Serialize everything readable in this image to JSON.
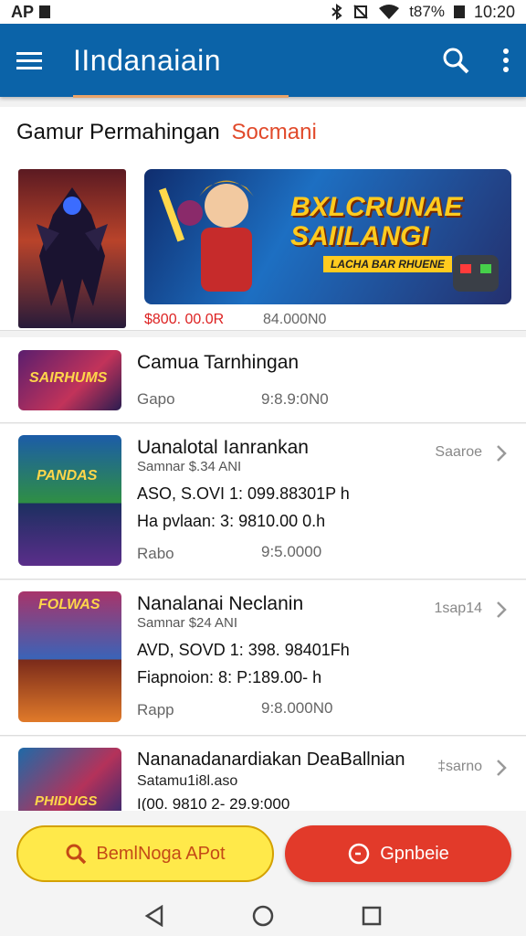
{
  "status_bar": {
    "left_text": "AP",
    "battery": "t87%",
    "time": "10:20"
  },
  "app_bar": {
    "title": "IIndanaiain",
    "menu_icon": "menu-icon",
    "search_icon": "search-icon",
    "more_icon": "more-vert-icon",
    "color": "#0b63a8"
  },
  "featured": {
    "heading": "Gamur Permahingan",
    "heading_accent": "Socmani",
    "banner_title": "BXLCRUNAE SAIILANGI",
    "banner_sub": "LACHA BAR RHUENE",
    "price_primary": "$800. 00.0R",
    "price_secondary": "84.000N0"
  },
  "list": [
    {
      "title": "Camua Tarnhingan",
      "left": "Gapo",
      "price": "9:8.9:0N0",
      "thumb_label": "SAIRHUMS"
    },
    {
      "title": "Uanalotal Ianrankan",
      "subtitle": "Samnar $.34 ANI",
      "line1": "ASO, S.OVI   1: 099.88301P h",
      "line2": "Ha pvlaan: 3: 9810.00 0.h",
      "left": "Rabo",
      "price": "9:5.0000",
      "tag": "Saaroe",
      "thumb_label": "PANDAS"
    },
    {
      "title": "Nanalanai Neclanin",
      "subtitle": "Samnar $24 ANI",
      "line1": "AVD, SOVD   1: 398. 98401Fh",
      "line2": "Fiapnoion: 8: P:189.00- h",
      "left": "Rapp",
      "price": "9:8.000N0",
      "tag": "1sap14",
      "thumb_label": "FOLWAS"
    },
    {
      "title": "Nananadanardiakan DeaBallnian",
      "subtitle": "Satamu1i8l.aso",
      "line1": "I(00. 9810   2- 29.9:000",
      "tag": "‡sarno",
      "thumb_label": "PHIDUGS"
    }
  ],
  "bottom": {
    "primary_label": "BemlNoga APot",
    "secondary_label": "Gpnbeie",
    "primary_icon": "search-icon",
    "secondary_icon": "chat-icon"
  },
  "nav": {
    "back": "back-icon",
    "home": "home-icon",
    "recents": "recents-icon"
  }
}
